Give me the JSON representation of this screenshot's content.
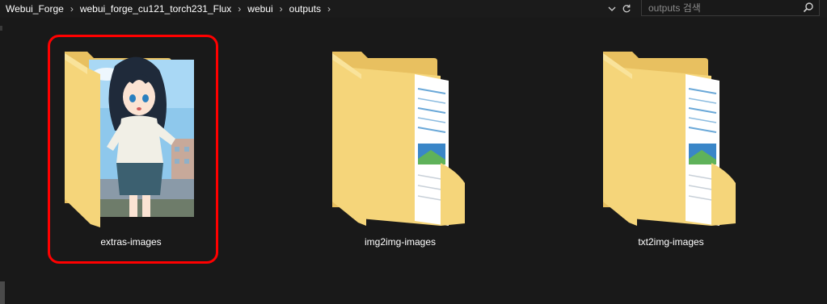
{
  "breadcrumb": {
    "items": [
      "Webui_Forge",
      "webui_forge_cu121_torch231_Flux",
      "webui",
      "outputs"
    ],
    "separator": "›"
  },
  "search": {
    "placeholder": "outputs 검색"
  },
  "icons": {
    "dropdown": "chevron-down-icon",
    "refresh": "refresh-icon",
    "search": "search-icon"
  },
  "folders": [
    {
      "label": "extras-images",
      "thumbnail": "anime-girl-image-preview",
      "selected": true
    },
    {
      "label": "img2img-images",
      "thumbnail": "document-preview",
      "selected": false
    },
    {
      "label": "txt2img-images",
      "thumbnail": "document-preview",
      "selected": false
    }
  ],
  "colors": {
    "background": "#191919",
    "folder": "#f5d57a",
    "folder_shade": "#e8c060",
    "highlight": "#ff0000",
    "text": "#ffffff"
  }
}
